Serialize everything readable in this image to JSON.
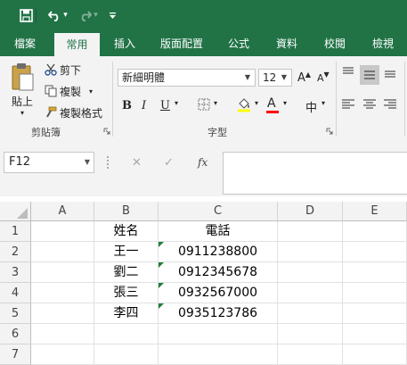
{
  "qat": {
    "undo_arrow": "▾",
    "customize_arrow": "▾"
  },
  "tabs": [
    "檔案",
    "常用",
    "插入",
    "版面配置",
    "公式",
    "資料",
    "校閱",
    "檢視"
  ],
  "clipboard": {
    "paste_label": "貼上",
    "cut_label": "剪下",
    "copy_label": "複製",
    "format_painter_label": "複製格式",
    "group_label": "剪貼簿"
  },
  "font": {
    "name": "新細明體",
    "size": "12",
    "bold": "B",
    "italic": "I",
    "underline": "U",
    "grow": "A",
    "shrink": "A",
    "phonetic": "中",
    "font_color_letter": "A",
    "group_label": "字型",
    "highlight_color": "#ffff00",
    "font_color": "#ff0000"
  },
  "formula_bar": {
    "name_box": "F12",
    "cancel": "✕",
    "enter": "✓",
    "fx": "fx",
    "formula": ""
  },
  "grid": {
    "columns": [
      "A",
      "B",
      "C",
      "D",
      "E"
    ],
    "rows": [
      "1",
      "2",
      "3",
      "4",
      "5",
      "6",
      "7"
    ],
    "cells": {
      "B1": "姓名",
      "C1": "電話",
      "B2": "王一",
      "C2": "0911238800",
      "B3": "劉二",
      "C3": "0912345678",
      "B4": "張三",
      "C4": "0932567000",
      "B5": "李四",
      "C5": "0935123786"
    }
  },
  "colors": {
    "excel_green": "#217346",
    "ribbon_bg": "#f3f3f3",
    "error_triangle": "#1e7e34"
  }
}
